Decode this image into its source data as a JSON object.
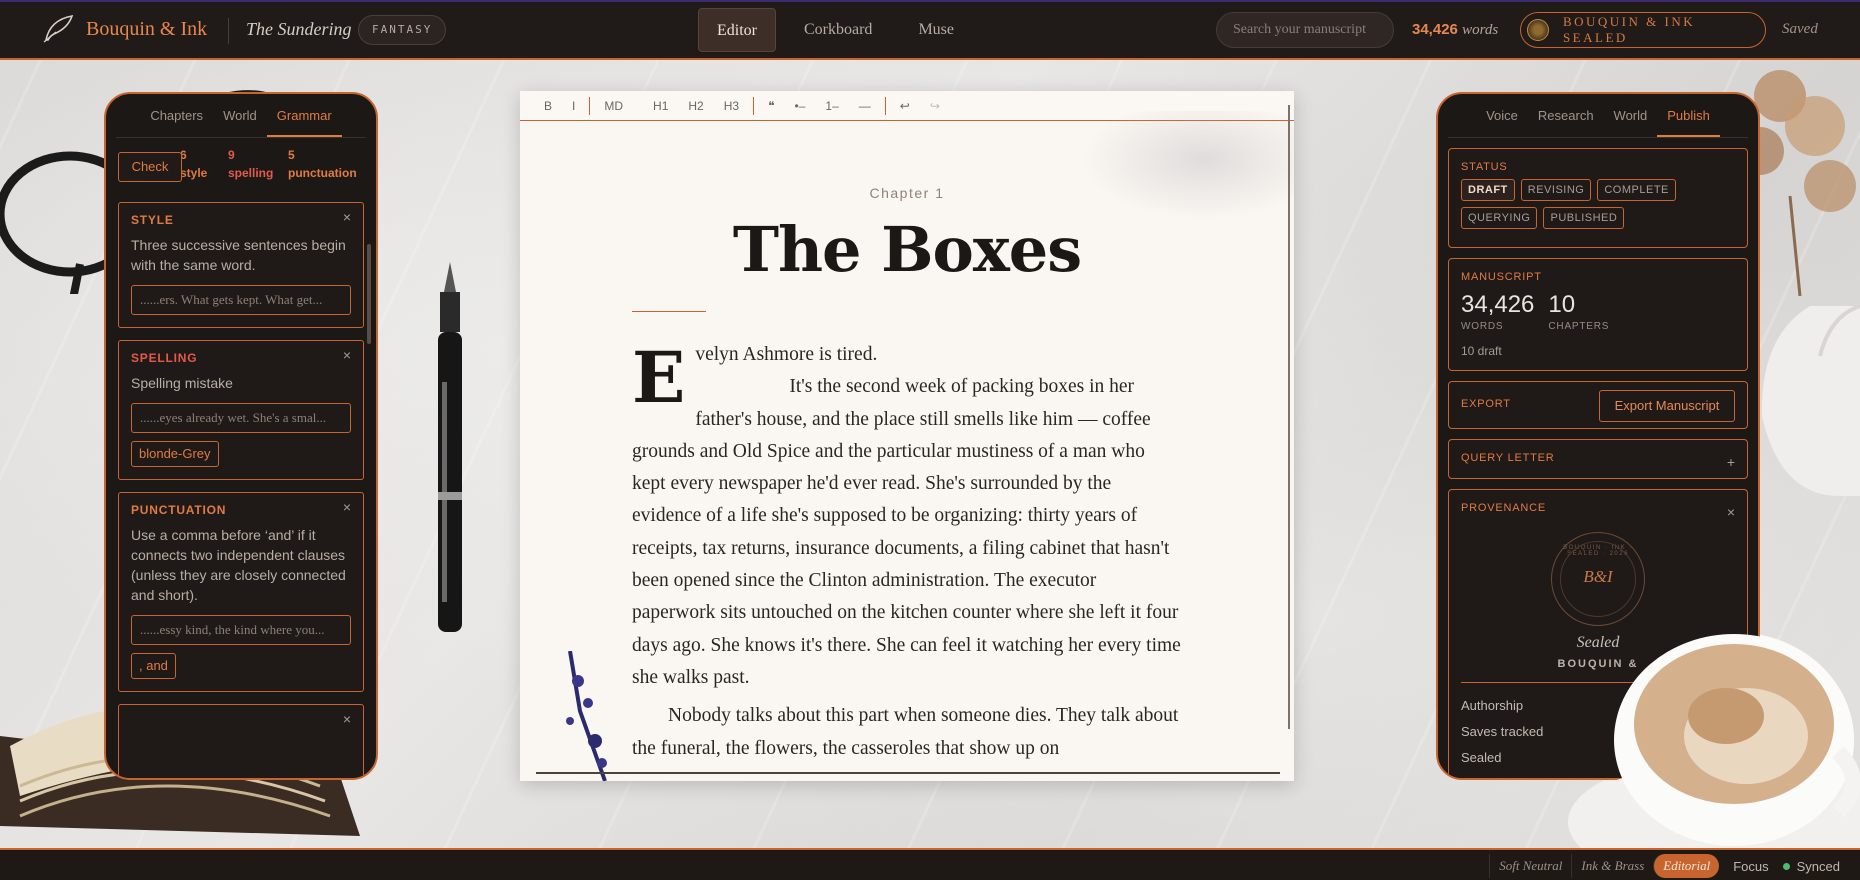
{
  "app": {
    "brand": "Bouquin & Ink",
    "book_title": "The Sundering",
    "genre": "FANTASY",
    "nav_tabs": [
      "Editor",
      "Corkboard",
      "Muse"
    ],
    "active_nav": "Editor",
    "search_placeholder": "Search your manuscript",
    "word_count": "34,426",
    "word_label": "words",
    "sealed_label": "BOUQUIN & INK SEALED",
    "save_status": "Saved"
  },
  "left_panel": {
    "tabs": [
      "Chapters",
      "World",
      "Grammar"
    ],
    "active_tab": "Grammar",
    "check_label": "Check",
    "stats": {
      "style": "6",
      "style_label": "style",
      "spelling": "9",
      "spelling_label": "spelling",
      "punct": "5",
      "punct_label": "punctuation"
    },
    "cards": [
      {
        "type": "STYLE",
        "message": "Three successive sentences begin with the same word.",
        "context": "......ers. What gets kept. What get..."
      },
      {
        "type": "SPELLING",
        "message": "Spelling mistake",
        "context": "......eyes already wet. She's a smal...",
        "suggestion": "blonde-Grey"
      },
      {
        "type": "PUNCTUATION",
        "message": "Use a comma before ‘and’ if it connects two independent clauses (unless they are closely connected and short).",
        "context": "......essy kind, the kind where you...",
        "suggestion": ", and"
      }
    ],
    "close_glyph": "×"
  },
  "editor": {
    "toolbar": [
      "B",
      "I",
      "MD",
      "H1",
      "H2",
      "H3",
      "❝",
      "•–",
      "1–",
      "—",
      "↩",
      "↪"
    ],
    "chapter_label": "Chapter 1",
    "title": "The Boxes",
    "drop_cap": "E",
    "first_line": "velyn Ashmore is tired.",
    "paragraphs": [
      "It's the second week of packing boxes in her father's house, and the place still smells like him — coffee grounds and Old Spice and the particular mustiness of a man who kept every newspaper he'd ever read. She's surrounded by the evidence of a life she's supposed to be organizing: thirty years of receipts, tax returns, insurance documents, a filing cabinet that hasn't been opened since the Clinton administration. The executor paperwork sits untouched on the kitchen counter where she left it four days ago. She knows it's there. She can feel it watching her every time she walks past.",
      "Nobody talks about this part when someone dies. They talk about the funeral, the flowers, the casseroles that show up on"
    ]
  },
  "right_panel": {
    "tabs": [
      "Voice",
      "Research",
      "World",
      "Publish"
    ],
    "active_tab": "Publish",
    "status_label": "STATUS",
    "statuses": [
      "DRAFT",
      "REVISING",
      "COMPLETE",
      "QUERYING",
      "PUBLISHED"
    ],
    "active_status": "DRAFT",
    "manuscript_label": "MANUSCRIPT",
    "words": "34,426",
    "words_label": "WORDS",
    "chapters": "10",
    "chapters_label": "CHAPTERS",
    "draft_note": "10 draft",
    "export_label": "EXPORT",
    "export_button": "Export Manuscript",
    "query_label": "QUERY LETTER",
    "query_toggle": "+",
    "provenance_label": "PROVENANCE",
    "provenance_toggle": "×",
    "seal_monogram": "B&I",
    "seal_ring_text": "BOUQUIN · INK · SEALED · 2026",
    "sealed_text": "Sealed",
    "sealed_brand": "BOUQUIN &",
    "rows": [
      "Authorship",
      "Saves tracked",
      "Sealed"
    ]
  },
  "bottom": {
    "themes": [
      "Soft Neutral",
      "Ink & Brass",
      "Editorial"
    ],
    "active_theme": "Editorial",
    "focus_label": "Focus",
    "sync_label": "Synced"
  },
  "colors": {
    "accent": "#c8642e",
    "panel_bg": "#1c1816",
    "paper": "#faf7f2",
    "synced": "#4fbb72"
  }
}
